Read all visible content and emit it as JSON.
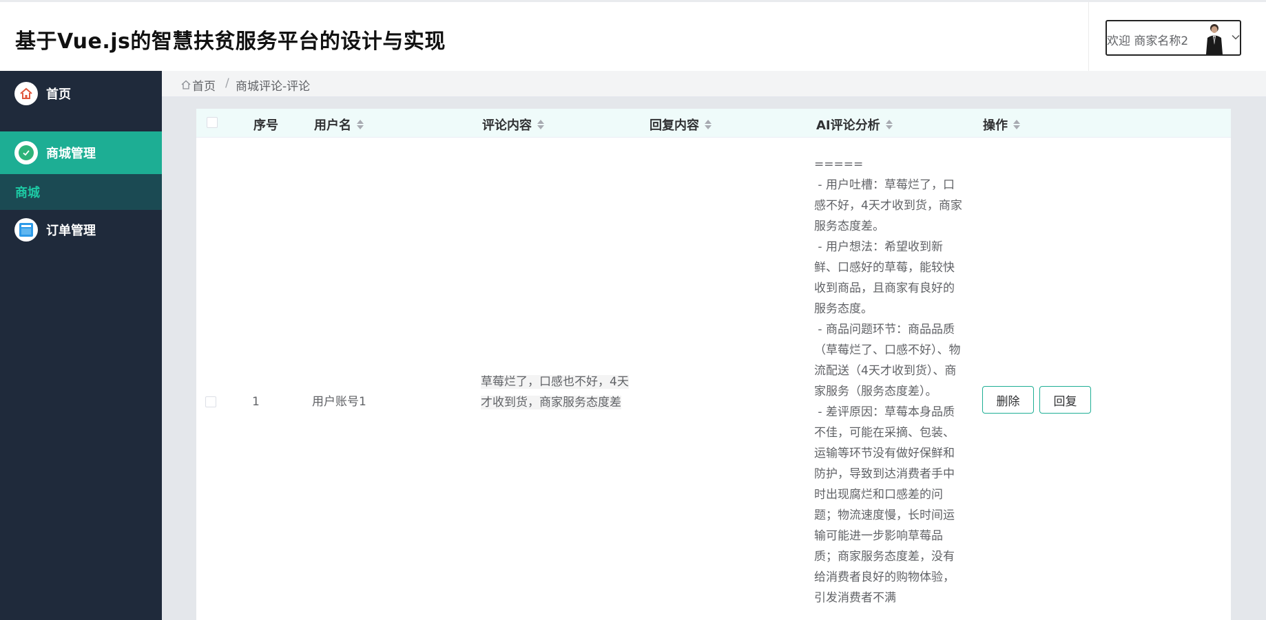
{
  "header": {
    "title": "基于Vue.js的智慧扶贫服务平台的设计与实现",
    "welcome": "欢迎 商家名称2",
    "avatar_icon": "user-avatar",
    "dropdown_icon": "chevron-down-icon"
  },
  "sidebar": {
    "items": [
      {
        "label": "首页",
        "icon": "home-icon",
        "active": false
      },
      {
        "label": "商城管理",
        "icon": "check-circle-icon",
        "active": true
      },
      {
        "label": "订单管理",
        "icon": "window-icon",
        "active": false
      }
    ],
    "submenu": {
      "label": "商城"
    }
  },
  "breadcrumb": {
    "home": "首页",
    "separator": "/",
    "current": "商城评论-评论"
  },
  "table": {
    "columns": [
      "序号",
      "用户名",
      "评论内容",
      "回复内容",
      "AI评论分析",
      "操作"
    ],
    "rows": [
      {
        "index": "1",
        "username": "用户账号1",
        "comment": "草莓烂了，口感也不好，4天才收到货，商家服务态度差",
        "reply": "",
        "ai_analysis": "=====\n - 用户吐槽：草莓烂了，口感不好，4天才收到货，商家服务态度差。\n - 用户想法：希望收到新鲜、口感好的草莓，能较快收到商品，且商家有良好的服务态度。\n - 商品问题环节：商品品质（草莓烂了、口感不好）、物流配送（4天才收到货）、商家服务（服务态度差）。\n - 差评原因：草莓本身品质不佳，可能在采摘、包装、运输等环节没有做好保鲜和防护，导致到达消费者手中时出现腐烂和口感差的问题；物流速度慢，长时间运输可能进一步影响草莓品质；商家服务态度差，没有给消费者良好的购物体验，引发消费者不满",
        "actions": {
          "delete": "删除",
          "reply": "回复"
        }
      }
    ]
  },
  "colors": {
    "accent": "#1dae94",
    "sidebar_bg": "#1f2a3b",
    "submenu_bg": "#1b4a53",
    "table_header_bg": "#effbfa"
  }
}
